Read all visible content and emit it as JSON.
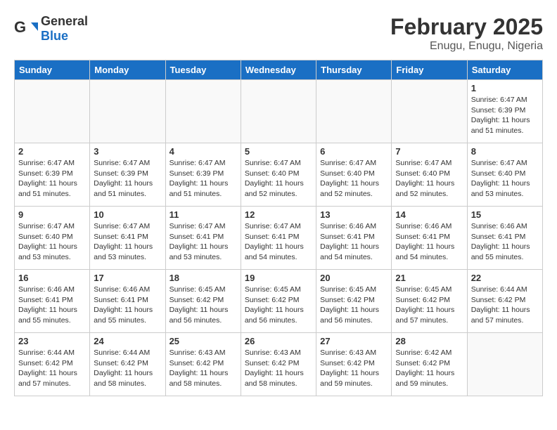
{
  "header": {
    "logo_general": "General",
    "logo_blue": "Blue",
    "main_title": "February 2025",
    "subtitle": "Enugu, Enugu, Nigeria"
  },
  "days_of_week": [
    "Sunday",
    "Monday",
    "Tuesday",
    "Wednesday",
    "Thursday",
    "Friday",
    "Saturday"
  ],
  "weeks": [
    [
      {
        "day": "",
        "info": ""
      },
      {
        "day": "",
        "info": ""
      },
      {
        "day": "",
        "info": ""
      },
      {
        "day": "",
        "info": ""
      },
      {
        "day": "",
        "info": ""
      },
      {
        "day": "",
        "info": ""
      },
      {
        "day": "1",
        "info": "Sunrise: 6:47 AM\nSunset: 6:39 PM\nDaylight: 11 hours\nand 51 minutes."
      }
    ],
    [
      {
        "day": "2",
        "info": "Sunrise: 6:47 AM\nSunset: 6:39 PM\nDaylight: 11 hours\nand 51 minutes."
      },
      {
        "day": "3",
        "info": "Sunrise: 6:47 AM\nSunset: 6:39 PM\nDaylight: 11 hours\nand 51 minutes."
      },
      {
        "day": "4",
        "info": "Sunrise: 6:47 AM\nSunset: 6:39 PM\nDaylight: 11 hours\nand 51 minutes."
      },
      {
        "day": "5",
        "info": "Sunrise: 6:47 AM\nSunset: 6:40 PM\nDaylight: 11 hours\nand 52 minutes."
      },
      {
        "day": "6",
        "info": "Sunrise: 6:47 AM\nSunset: 6:40 PM\nDaylight: 11 hours\nand 52 minutes."
      },
      {
        "day": "7",
        "info": "Sunrise: 6:47 AM\nSunset: 6:40 PM\nDaylight: 11 hours\nand 52 minutes."
      },
      {
        "day": "8",
        "info": "Sunrise: 6:47 AM\nSunset: 6:40 PM\nDaylight: 11 hours\nand 53 minutes."
      }
    ],
    [
      {
        "day": "9",
        "info": "Sunrise: 6:47 AM\nSunset: 6:40 PM\nDaylight: 11 hours\nand 53 minutes."
      },
      {
        "day": "10",
        "info": "Sunrise: 6:47 AM\nSunset: 6:41 PM\nDaylight: 11 hours\nand 53 minutes."
      },
      {
        "day": "11",
        "info": "Sunrise: 6:47 AM\nSunset: 6:41 PM\nDaylight: 11 hours\nand 53 minutes."
      },
      {
        "day": "12",
        "info": "Sunrise: 6:47 AM\nSunset: 6:41 PM\nDaylight: 11 hours\nand 54 minutes."
      },
      {
        "day": "13",
        "info": "Sunrise: 6:46 AM\nSunset: 6:41 PM\nDaylight: 11 hours\nand 54 minutes."
      },
      {
        "day": "14",
        "info": "Sunrise: 6:46 AM\nSunset: 6:41 PM\nDaylight: 11 hours\nand 54 minutes."
      },
      {
        "day": "15",
        "info": "Sunrise: 6:46 AM\nSunset: 6:41 PM\nDaylight: 11 hours\nand 55 minutes."
      }
    ],
    [
      {
        "day": "16",
        "info": "Sunrise: 6:46 AM\nSunset: 6:41 PM\nDaylight: 11 hours\nand 55 minutes."
      },
      {
        "day": "17",
        "info": "Sunrise: 6:46 AM\nSunset: 6:41 PM\nDaylight: 11 hours\nand 55 minutes."
      },
      {
        "day": "18",
        "info": "Sunrise: 6:45 AM\nSunset: 6:42 PM\nDaylight: 11 hours\nand 56 minutes."
      },
      {
        "day": "19",
        "info": "Sunrise: 6:45 AM\nSunset: 6:42 PM\nDaylight: 11 hours\nand 56 minutes."
      },
      {
        "day": "20",
        "info": "Sunrise: 6:45 AM\nSunset: 6:42 PM\nDaylight: 11 hours\nand 56 minutes."
      },
      {
        "day": "21",
        "info": "Sunrise: 6:45 AM\nSunset: 6:42 PM\nDaylight: 11 hours\nand 57 minutes."
      },
      {
        "day": "22",
        "info": "Sunrise: 6:44 AM\nSunset: 6:42 PM\nDaylight: 11 hours\nand 57 minutes."
      }
    ],
    [
      {
        "day": "23",
        "info": "Sunrise: 6:44 AM\nSunset: 6:42 PM\nDaylight: 11 hours\nand 57 minutes."
      },
      {
        "day": "24",
        "info": "Sunrise: 6:44 AM\nSunset: 6:42 PM\nDaylight: 11 hours\nand 58 minutes."
      },
      {
        "day": "25",
        "info": "Sunrise: 6:43 AM\nSunset: 6:42 PM\nDaylight: 11 hours\nand 58 minutes."
      },
      {
        "day": "26",
        "info": "Sunrise: 6:43 AM\nSunset: 6:42 PM\nDaylight: 11 hours\nand 58 minutes."
      },
      {
        "day": "27",
        "info": "Sunrise: 6:43 AM\nSunset: 6:42 PM\nDaylight: 11 hours\nand 59 minutes."
      },
      {
        "day": "28",
        "info": "Sunrise: 6:42 AM\nSunset: 6:42 PM\nDaylight: 11 hours\nand 59 minutes."
      },
      {
        "day": "",
        "info": ""
      }
    ]
  ]
}
